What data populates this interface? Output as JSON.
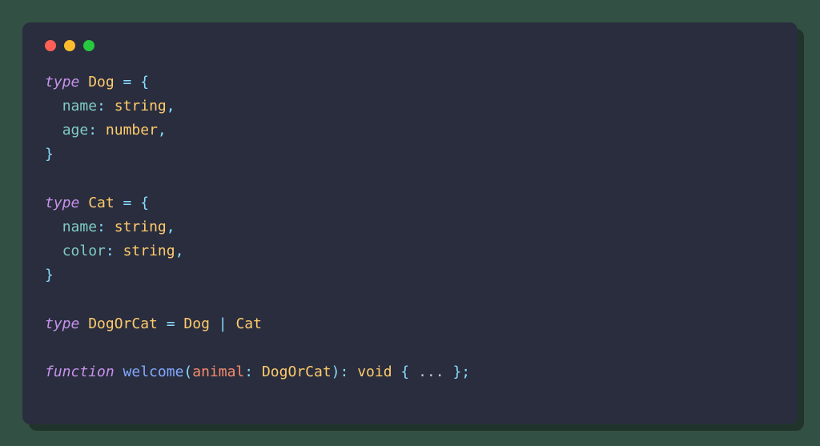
{
  "window": {
    "dots": [
      "red",
      "yellow",
      "green"
    ]
  },
  "code": {
    "lines": [
      [
        {
          "c": "c-keyword",
          "t": "type "
        },
        {
          "c": "c-typename",
          "t": "Dog"
        },
        {
          "c": "c-punct",
          "t": " = {"
        }
      ],
      [
        {
          "c": "c-plain",
          "t": "  "
        },
        {
          "c": "c-prop",
          "t": "name"
        },
        {
          "c": "c-punct",
          "t": ": "
        },
        {
          "c": "c-builtin",
          "t": "string"
        },
        {
          "c": "c-punct",
          "t": ","
        }
      ],
      [
        {
          "c": "c-plain",
          "t": "  "
        },
        {
          "c": "c-prop",
          "t": "age"
        },
        {
          "c": "c-punct",
          "t": ": "
        },
        {
          "c": "c-builtin",
          "t": "number"
        },
        {
          "c": "c-punct",
          "t": ","
        }
      ],
      [
        {
          "c": "c-punct",
          "t": "}"
        }
      ],
      [
        {
          "c": "c-plain",
          "t": ""
        }
      ],
      [
        {
          "c": "c-keyword",
          "t": "type "
        },
        {
          "c": "c-typename",
          "t": "Cat"
        },
        {
          "c": "c-punct",
          "t": " = {"
        }
      ],
      [
        {
          "c": "c-plain",
          "t": "  "
        },
        {
          "c": "c-prop",
          "t": "name"
        },
        {
          "c": "c-punct",
          "t": ": "
        },
        {
          "c": "c-builtin",
          "t": "string"
        },
        {
          "c": "c-punct",
          "t": ","
        }
      ],
      [
        {
          "c": "c-plain",
          "t": "  "
        },
        {
          "c": "c-prop",
          "t": "color"
        },
        {
          "c": "c-punct",
          "t": ": "
        },
        {
          "c": "c-builtin",
          "t": "string"
        },
        {
          "c": "c-punct",
          "t": ","
        }
      ],
      [
        {
          "c": "c-punct",
          "t": "}"
        }
      ],
      [
        {
          "c": "c-plain",
          "t": ""
        }
      ],
      [
        {
          "c": "c-keyword",
          "t": "type "
        },
        {
          "c": "c-typename",
          "t": "DogOrCat"
        },
        {
          "c": "c-punct",
          "t": " = "
        },
        {
          "c": "c-typename",
          "t": "Dog"
        },
        {
          "c": "c-punct",
          "t": " | "
        },
        {
          "c": "c-typename",
          "t": "Cat"
        }
      ],
      [
        {
          "c": "c-plain",
          "t": ""
        }
      ],
      [
        {
          "c": "c-funckw",
          "t": "function "
        },
        {
          "c": "c-funcname",
          "t": "welcome"
        },
        {
          "c": "c-punct",
          "t": "("
        },
        {
          "c": "c-param",
          "t": "animal"
        },
        {
          "c": "c-punct",
          "t": ": "
        },
        {
          "c": "c-typename",
          "t": "DogOrCat"
        },
        {
          "c": "c-punct",
          "t": ")"
        },
        {
          "c": "c-punct",
          "t": ": "
        },
        {
          "c": "c-builtin",
          "t": "void"
        },
        {
          "c": "c-plain",
          "t": " "
        },
        {
          "c": "c-punct",
          "t": "{"
        },
        {
          "c": "c-plain",
          "t": " ... "
        },
        {
          "c": "c-punct",
          "t": "}"
        },
        {
          "c": "c-punct",
          "t": ";"
        }
      ]
    ]
  }
}
